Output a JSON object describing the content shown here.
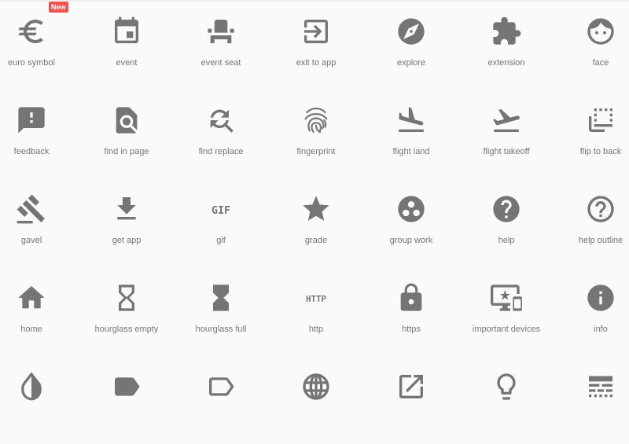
{
  "icon_color": "#757575",
  "badge_color": "#ef5350",
  "icons": [
    {
      "icon": "euro-symbol",
      "label": "euro symbol",
      "badge": "New"
    },
    {
      "icon": "event",
      "label": "event"
    },
    {
      "icon": "event-seat",
      "label": "event seat"
    },
    {
      "icon": "exit-to-app",
      "label": "exit to app"
    },
    {
      "icon": "explore",
      "label": "explore"
    },
    {
      "icon": "extension",
      "label": "extension"
    },
    {
      "icon": "face",
      "label": "face"
    },
    {
      "icon": "feedback",
      "label": "feedback"
    },
    {
      "icon": "find-in-page",
      "label": "find in page"
    },
    {
      "icon": "find-replace",
      "label": "find replace"
    },
    {
      "icon": "fingerprint",
      "label": "fingerprint"
    },
    {
      "icon": "flight-land",
      "label": "flight land"
    },
    {
      "icon": "flight-takeoff",
      "label": "flight takeoff"
    },
    {
      "icon": "flip-to-back",
      "label": "flip to back"
    },
    {
      "icon": "gavel",
      "label": "gavel"
    },
    {
      "icon": "get-app",
      "label": "get app"
    },
    {
      "icon": "gif",
      "label": "gif"
    },
    {
      "icon": "grade",
      "label": "grade"
    },
    {
      "icon": "group-work",
      "label": "group work"
    },
    {
      "icon": "help",
      "label": "help"
    },
    {
      "icon": "help-outline",
      "label": "help outline"
    },
    {
      "icon": "home",
      "label": "home"
    },
    {
      "icon": "hourglass-empty",
      "label": "hourglass empty"
    },
    {
      "icon": "hourglass-full",
      "label": "hourglass full"
    },
    {
      "icon": "http",
      "label": "http"
    },
    {
      "icon": "https",
      "label": "https"
    },
    {
      "icon": "important-devices",
      "label": "important devices"
    },
    {
      "icon": "info",
      "label": "info"
    },
    {
      "icon": "invert-colors"
    },
    {
      "icon": "label"
    },
    {
      "icon": "label-outline"
    },
    {
      "icon": "language"
    },
    {
      "icon": "launch"
    },
    {
      "icon": "lightbulb-outline"
    },
    {
      "icon": "line-style"
    }
  ]
}
